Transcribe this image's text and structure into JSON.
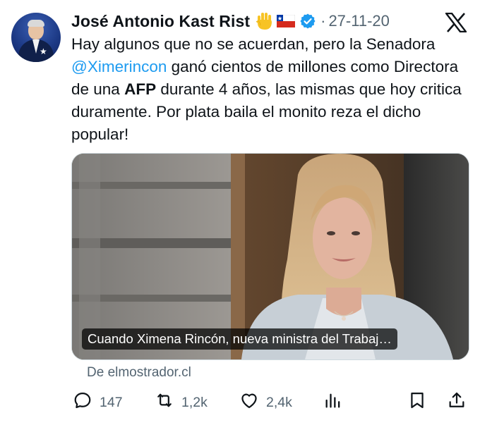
{
  "tweet": {
    "author_name": "José Antonio Kast Rist",
    "date": "27-11-20",
    "separator": "·",
    "emojis": [
      "raised-hand",
      "chile-flag"
    ],
    "text_parts": [
      {
        "t": "Hay algunos que no se acuerdan, pero la Senadora "
      },
      {
        "t": "@Ximerincon",
        "style": "mention"
      },
      {
        "t": " ganó cientos de millones como Directora de una "
      },
      {
        "t": "AFP",
        "style": "bold"
      },
      {
        "t": " durante 4 años, las mismas que hoy critica duramente. Por plata baila el monito reza el dicho popular!"
      }
    ],
    "card": {
      "caption": "Cuando Ximena Rincón, nueva ministra del Trabaj…",
      "source": "De elmostrador.cl"
    },
    "actions": {
      "replies": "147",
      "retweets": "1,2k",
      "likes": "2,4k"
    }
  },
  "icons": {
    "logo": "x-logo-icon",
    "verified": "verified-badge-icon",
    "reply": "reply-icon",
    "retweet": "retweet-icon",
    "like": "like-icon",
    "views": "views-icon",
    "bookmark": "bookmark-icon",
    "share": "share-icon"
  },
  "colors": {
    "accent": "#1d9bf0",
    "text": "#0f1419",
    "secondary": "#536471"
  }
}
